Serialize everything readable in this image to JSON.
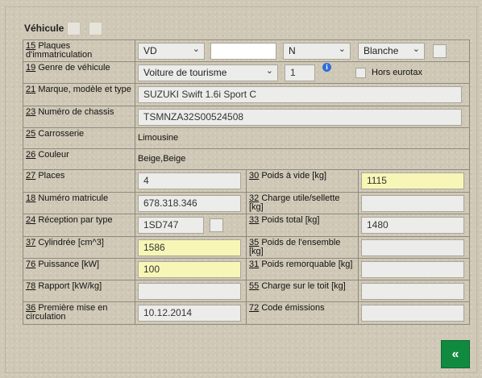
{
  "section_title": "Véhicule",
  "rows": {
    "plates": {
      "num": "15",
      "label": "Plaques d'immatriculation",
      "canton": "VD",
      "number": "",
      "type": "N",
      "color": "Blanche"
    },
    "genre": {
      "num": "19",
      "label": "Genre de véhicule",
      "value": "Voiture de tourisme",
      "count": "1",
      "eurotax_label": "Hors eurotax"
    },
    "marque": {
      "num": "21",
      "label": "Marque, modèle et type",
      "value": "SUZUKI Swift 1.6i Sport C"
    },
    "chassis": {
      "num": "23",
      "label": "Numéro de chassis",
      "value": "TSMNZA32S00524508"
    },
    "carrosserie": {
      "num": "25",
      "label": "Carrosserie",
      "value": "Limousine"
    },
    "couleur": {
      "num": "26",
      "label": "Couleur",
      "value": "Beige,Beige"
    },
    "places": {
      "num": "27",
      "label": "Places",
      "value": "4"
    },
    "poids_vide": {
      "num": "30",
      "label": "Poids à vide [kg]",
      "value": "1115"
    },
    "matricule": {
      "num": "18",
      "label": "Numéro matricule",
      "value": "678.318.346"
    },
    "charge_utile": {
      "num": "32",
      "label": "Charge utile/sellette [kg]",
      "value": ""
    },
    "reception": {
      "num": "24",
      "label": "Réception par type",
      "value": "1SD747"
    },
    "poids_total": {
      "num": "33",
      "label": "Poids total [kg]",
      "value": "1480"
    },
    "cylindree": {
      "num": "37",
      "label": "Cylindrée [cm^3]",
      "value": "1586"
    },
    "poids_ensemble": {
      "num": "35",
      "label": "Poids de l'ensemble [kg]",
      "value": ""
    },
    "puissance": {
      "num": "76",
      "label": "Puissance [kW]",
      "value": "100"
    },
    "poids_remorquable": {
      "num": "31",
      "label": "Poids remorquable [kg]",
      "value": ""
    },
    "rapport": {
      "num": "78",
      "label": "Rapport [kW/kg]",
      "value": ""
    },
    "charge_toit": {
      "num": "55",
      "label": "Charge sur le toit [kg]",
      "value": ""
    },
    "premiere_mise": {
      "num": "36",
      "label": "Première mise en circulation",
      "value": "10.12.2014"
    },
    "code_emissions": {
      "num": "72",
      "label": "Code émissions",
      "value": ""
    }
  },
  "back_button_label": "«",
  "icons": {
    "info": "info-icon",
    "dropdown": "chevron-down-icon"
  },
  "colors": {
    "highlight_field": "#f7f6b6",
    "back_button": "#108a3f",
    "info": "#2f6fd6"
  }
}
